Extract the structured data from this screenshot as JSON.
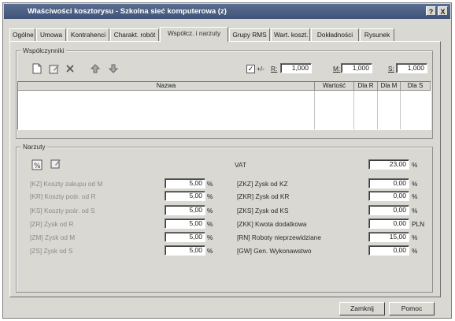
{
  "window": {
    "title": "Właściwości kosztorysu - Szkolna sieć komputerowa (z)",
    "help_label": "?",
    "close_label": "X"
  },
  "tabs": [
    {
      "label": "Ogólne"
    },
    {
      "label": "Umowa"
    },
    {
      "label": "Kontrahenci"
    },
    {
      "label": "Charakt. robót"
    },
    {
      "label": "Współcz. i narzuty"
    },
    {
      "label": "Grupy RMS"
    },
    {
      "label": "Wart. koszt."
    },
    {
      "label": "Dokładności"
    },
    {
      "label": "Rysunek"
    }
  ],
  "active_tab_index": 4,
  "wspolczynniki": {
    "legend": "Współczynniki",
    "checkbox_label": "+/-",
    "checkbox_checked": true,
    "r_label": "R:",
    "r_value": "1,000",
    "m_label": "M:",
    "m_value": "1,000",
    "s_label": "S:",
    "s_value": "1,000",
    "columns": [
      "Nazwa",
      "Wartość",
      "Dla R",
      "Dla M",
      "Dla S"
    ],
    "icons": [
      "new-document-icon",
      "edit-icon",
      "delete-icon",
      "move-up-icon",
      "move-down-icon"
    ]
  },
  "narzuty": {
    "legend": "Narzuty",
    "vat_label": "VAT",
    "vat_value": "23,00",
    "vat_unit": "%",
    "left": [
      {
        "label": "[KZ] Koszty zakupu od M",
        "value": "5,00",
        "unit": "%"
      },
      {
        "label": "[KR] Koszty pośr. od R",
        "value": "5,00",
        "unit": "%"
      },
      {
        "label": "[KS] Koszty pośr. od S",
        "value": "5,00",
        "unit": "%"
      },
      {
        "label": "[ZR] Zysk od R",
        "value": "5,00",
        "unit": "%"
      },
      {
        "label": "[ZM] Zysk od M",
        "value": "5,00",
        "unit": "%"
      },
      {
        "label": "[ZS] Zysk od S",
        "value": "5,00",
        "unit": "%"
      }
    ],
    "right": [
      {
        "label": "[ZKZ] Zysk od KZ",
        "value": "0,00",
        "unit": "%"
      },
      {
        "label": "[ZKR] Zysk od KR",
        "value": "0,00",
        "unit": "%"
      },
      {
        "label": "[ZKS] Zysk od KS",
        "value": "0,00",
        "unit": "%"
      },
      {
        "label": "[ZKK] Kwota dodatkowa",
        "value": "0,00",
        "unit": "PLN"
      },
      {
        "label": "[RN] Roboty nieprzewidziane",
        "value": "15,00",
        "unit": "%"
      },
      {
        "label": "[GW] Gen. Wykonawstwo",
        "value": "0,00",
        "unit": "%"
      }
    ]
  },
  "buttons": {
    "close_label": "Zamknij",
    "help_label": "Pomoc"
  }
}
